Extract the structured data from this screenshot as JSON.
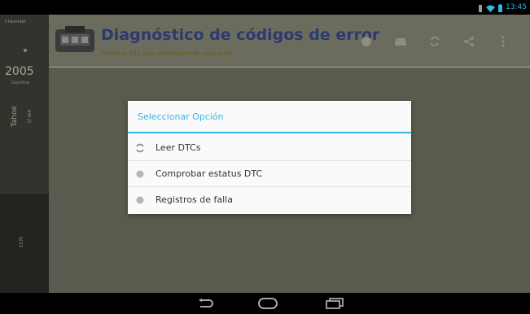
{
  "status_bar": {
    "icons": [
      "notification-icon",
      "wifi-icon",
      "battery-icon"
    ],
    "time": "13:45"
  },
  "vehicle": {
    "top_label": "Chevrolet",
    "year": "2005",
    "sub_label": "Gasolina",
    "model": "Tahoe",
    "model_sub": "LT 4x4",
    "ecu_label": "ECM"
  },
  "header": {
    "title": "Diagnóstico de códigos de error",
    "subtitle": "Presionar DTC para información de reparación",
    "actions": [
      "info-icon",
      "car-icon",
      "refresh-icon",
      "share-icon",
      "overflow-menu-icon"
    ]
  },
  "dialog": {
    "title": "Seleccionar Opción",
    "options": [
      {
        "label": "Leer DTCs",
        "icon": "refresh-icon"
      },
      {
        "label": "Comprobar estatus DTC",
        "icon": "info-icon"
      },
      {
        "label": "Registros de falla",
        "icon": "info-icon"
      }
    ]
  },
  "nav": {
    "buttons": [
      "back-icon",
      "home-icon",
      "recents-icon"
    ]
  },
  "colors": {
    "accent": "#33b5e5",
    "title": "#2c3a6f",
    "dim_background": "#5a5a4e"
  }
}
